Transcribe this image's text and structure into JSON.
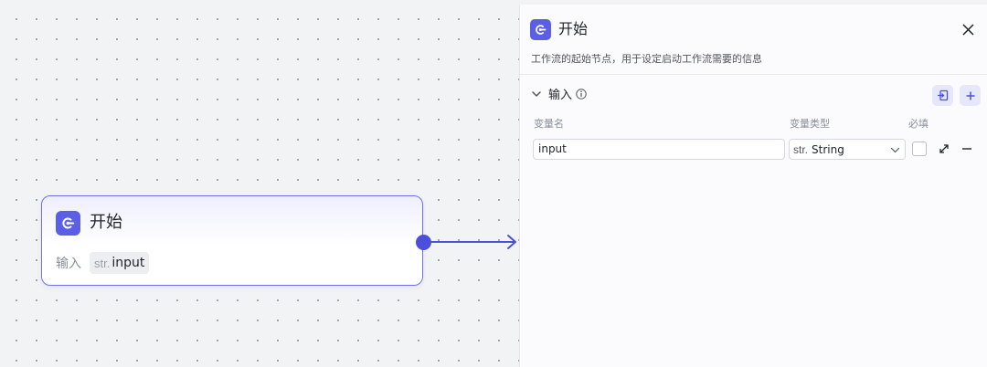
{
  "node": {
    "title": "开始",
    "input_label": "输入",
    "input_tag": {
      "type": "str.",
      "name": "input"
    }
  },
  "panel": {
    "title": "开始",
    "description": "工作流的起始节点，用于设定启动工作流需要的信息",
    "section": {
      "title": "输入"
    },
    "columns": {
      "name": "变量名",
      "type": "变量类型",
      "required": "必填"
    },
    "variable": {
      "name": "input",
      "type_prefix": "str.",
      "type": "String",
      "required": false
    }
  },
  "icons": [
    "start-icon",
    "close-icon",
    "chevron-down-icon",
    "info-icon",
    "import-icon",
    "plus-icon",
    "expand-icon",
    "minus-icon",
    "caret-down-icon"
  ],
  "colors": {
    "accent": "#5b5fe6",
    "edge": "#4b4fd9",
    "canvas": "#f2f3f5"
  }
}
